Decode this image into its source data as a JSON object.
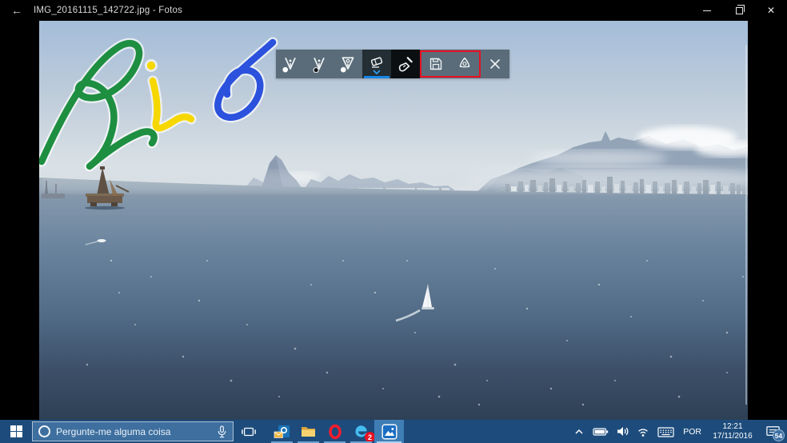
{
  "window": {
    "title": "IMG_20161115_142722.jpg - Fotos",
    "back_glyph": "←",
    "close_glyph": "✕"
  },
  "ink_toolbar": {
    "tools": [
      "ballpoint-pen",
      "pencil",
      "calligraphy-pen",
      "eraser",
      "touch-writing",
      "save",
      "share",
      "exit"
    ],
    "selected_tool": "eraser",
    "highlight_color": "#e81123",
    "highlight_style": "border-color:#e81123"
  },
  "ink": {
    "text": "Rio",
    "colors": {
      "R": "#1e8f41",
      "i": "#f6d800",
      "o": "#2b51dd"
    }
  },
  "photo": {
    "scene": [
      "sky",
      "clouds",
      "sugarloaf-mountain",
      "corcovado-range",
      "city-skyline",
      "sea",
      "oil-rig",
      "sailboat",
      "boat"
    ]
  },
  "taskbar": {
    "search": {
      "placeholder": "Pergunte-me alguma coisa"
    },
    "apps": [
      "outlook",
      "file-explorer",
      "opera",
      "edge",
      "photos"
    ],
    "active_app": "photos",
    "badges": {
      "edge": "2",
      "notifications": "54"
    },
    "tray_icons": [
      "hidden-icons-chevron",
      "battery",
      "volume",
      "wifi",
      "touch-keyboard"
    ],
    "language": "POR",
    "clock": {
      "time": "12:21",
      "date": "17/11/2016"
    }
  }
}
